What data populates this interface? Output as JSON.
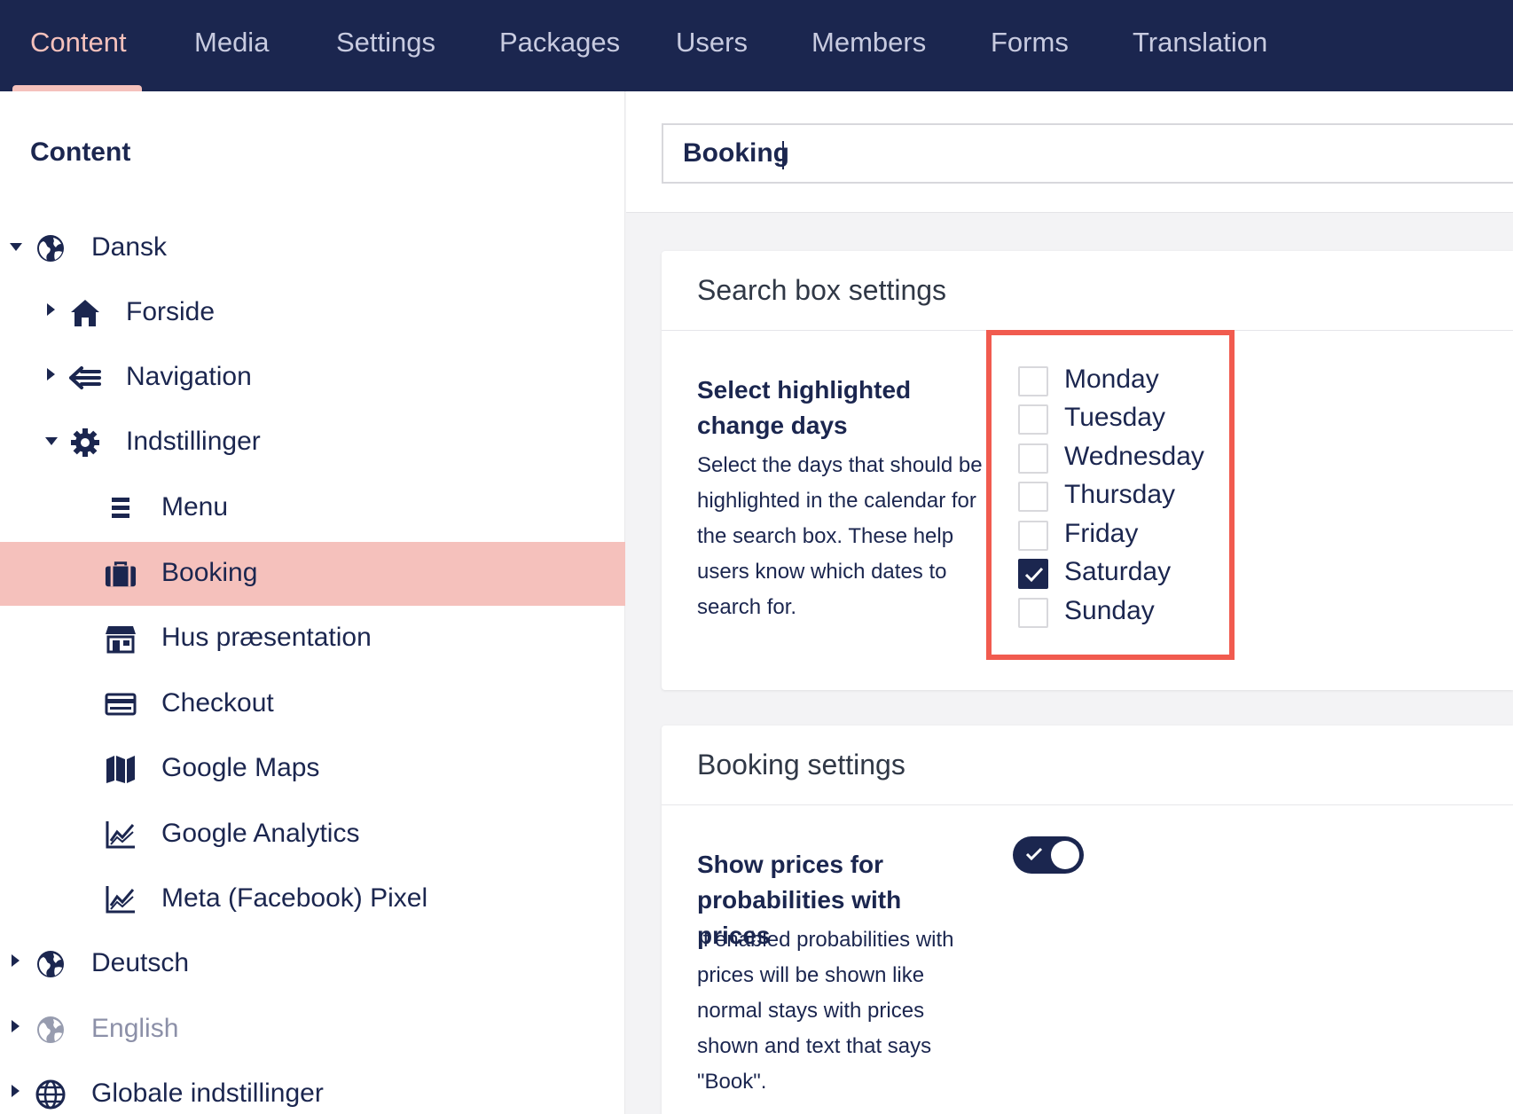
{
  "topnav": {
    "items": [
      "Content",
      "Media",
      "Settings",
      "Packages",
      "Users",
      "Members",
      "Forms",
      "Translation"
    ],
    "active": "Content"
  },
  "sidebar": {
    "title": "Content",
    "tree": [
      {
        "label": "Dansk",
        "icon": "globe-icon",
        "expanded": true
      },
      {
        "label": "Forside",
        "icon": "home-icon"
      },
      {
        "label": "Navigation",
        "icon": "navigation-icon"
      },
      {
        "label": "Indstillinger",
        "icon": "gear-icon",
        "expanded": true
      },
      {
        "label": "Menu",
        "icon": "menu-icon"
      },
      {
        "label": "Booking",
        "icon": "briefcase-icon",
        "selected": true
      },
      {
        "label": "Hus præsentation",
        "icon": "store-icon"
      },
      {
        "label": "Checkout",
        "icon": "credit-card-icon"
      },
      {
        "label": "Google Maps",
        "icon": "map-icon"
      },
      {
        "label": "Google Analytics",
        "icon": "chart-icon"
      },
      {
        "label": "Meta (Facebook) Pixel",
        "icon": "chart-icon"
      },
      {
        "label": "Deutsch",
        "icon": "globe-icon"
      },
      {
        "label": "English",
        "icon": "globe-icon",
        "muted": true
      },
      {
        "label": "Globale indstillinger",
        "icon": "world-icon"
      }
    ]
  },
  "editor": {
    "node_name": "Booking",
    "search_panel": {
      "title": "Search box settings",
      "property_label": "Select highlighted change days",
      "property_description": "Select the days that should be highlighted in the calendar for the search box. These help users know which dates to search for.",
      "days": [
        {
          "label": "Monday",
          "checked": false
        },
        {
          "label": "Tuesday",
          "checked": false
        },
        {
          "label": "Wednesday",
          "checked": false
        },
        {
          "label": "Thursday",
          "checked": false
        },
        {
          "label": "Friday",
          "checked": false
        },
        {
          "label": "Saturday",
          "checked": true
        },
        {
          "label": "Sunday",
          "checked": false
        }
      ]
    },
    "booking_panel": {
      "title": "Booking settings",
      "property_label": "Show prices for probabilities with prices",
      "property_description": "If enabled probabilities with prices will be shown like normal stays with prices shown and text that says \"Book\".",
      "toggle_on": true
    }
  },
  "colors": {
    "navy": "#1b264f",
    "active_pink": "#f5c1bc",
    "highlight_red": "#f15b4f"
  }
}
